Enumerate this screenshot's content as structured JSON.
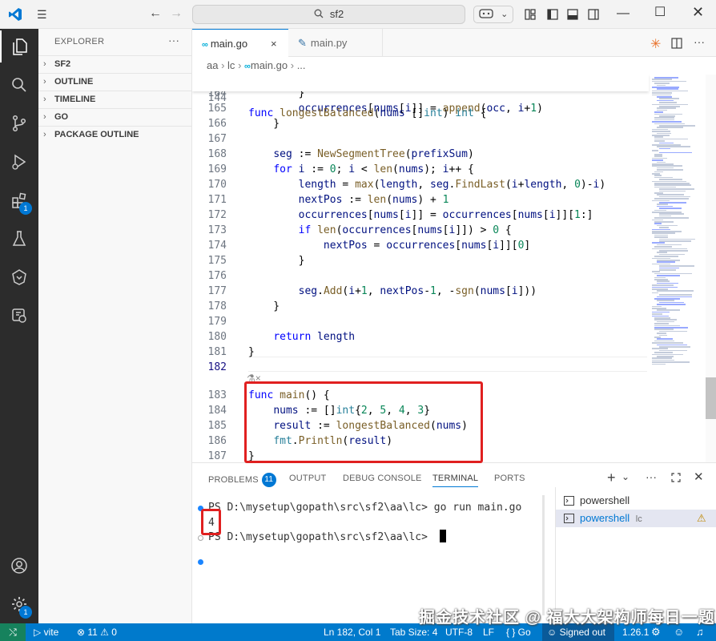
{
  "window": {
    "search_text": "sf2"
  },
  "sidebar": {
    "title": "EXPLORER",
    "more": "···",
    "sections": [
      {
        "label": "SF2"
      },
      {
        "label": "OUTLINE"
      },
      {
        "label": "TIMELINE"
      },
      {
        "label": "GO"
      },
      {
        "label": "PACKAGE OUTLINE"
      }
    ]
  },
  "activity_bar": {
    "extensions_badge": "1",
    "settings_badge": "1"
  },
  "tabs": [
    {
      "label": "main.go",
      "active": true,
      "close": "×"
    },
    {
      "label": "main.py",
      "active": false
    }
  ],
  "breadcrumb": [
    "aa",
    "lc",
    "main.go",
    "..."
  ],
  "editor": {
    "sticky_line": {
      "number": "144",
      "text": "func longestBalanced(nums []int) int {"
    },
    "lines": [
      {
        "number": "164",
        "text": "        }"
      },
      {
        "number": "165",
        "text": "        occurrences[nums[i]] = append(occ, i+1)"
      },
      {
        "number": "166",
        "text": "    }"
      },
      {
        "number": "167",
        "text": ""
      },
      {
        "number": "168",
        "text": "    seg := NewSegmentTree(prefixSum)"
      },
      {
        "number": "169",
        "text": "    for i := 0; i < len(nums); i++ {"
      },
      {
        "number": "170",
        "text": "        length = max(length, seg.FindLast(i+length, 0)-i)"
      },
      {
        "number": "171",
        "text": "        nextPos := len(nums) + 1"
      },
      {
        "number": "172",
        "text": "        occurrences[nums[i]] = occurrences[nums[i]][1:]"
      },
      {
        "number": "173",
        "text": "        if len(occurrences[nums[i]]) > 0 {"
      },
      {
        "number": "174",
        "text": "            nextPos = occurrences[nums[i]][0]"
      },
      {
        "number": "175",
        "text": "        }"
      },
      {
        "number": "176",
        "text": ""
      },
      {
        "number": "177",
        "text": "        seg.Add(i+1, nextPos-1, -sgn(nums[i]))"
      },
      {
        "number": "178",
        "text": "    }"
      },
      {
        "number": "179",
        "text": ""
      },
      {
        "number": "180",
        "text": "    return length"
      },
      {
        "number": "181",
        "text": "}"
      },
      {
        "number": "182",
        "text": ""
      },
      {
        "number": "",
        "text": ""
      },
      {
        "number": "183",
        "text": "func main() {"
      },
      {
        "number": "184",
        "text": "    nums := []int{2, 5, 4, 3}"
      },
      {
        "number": "185",
        "text": "    result := longestBalanced(nums)"
      },
      {
        "number": "186",
        "text": "    fmt.Println(result)"
      },
      {
        "number": "187",
        "text": "}"
      }
    ],
    "current_line": "182"
  },
  "panel": {
    "tabs": [
      {
        "label": "PROBLEMS",
        "badge": "11"
      },
      {
        "label": "OUTPUT"
      },
      {
        "label": "DEBUG CONSOLE"
      },
      {
        "label": "TERMINAL",
        "active": true
      },
      {
        "label": "PORTS"
      }
    ],
    "terminal_lines": [
      "PS D:\\mysetup\\gopath\\src\\sf2\\aa\\lc> go run main.go",
      "4",
      "PS D:\\mysetup\\gopath\\src\\sf2\\aa\\lc> "
    ],
    "terminals": [
      {
        "label": "powershell",
        "suffix": ""
      },
      {
        "label": "powershell",
        "suffix": "lc"
      }
    ]
  },
  "statusbar": {
    "vite": "vite",
    "problems": "⊗ 11 ⚠ 0",
    "position": "Ln 182, Col 1",
    "tab_size": "Tab Size: 4",
    "encoding": "UTF-8",
    "eol": "LF",
    "language": "{ } Go",
    "account": "Signed out",
    "go_version": "1.26.1"
  },
  "watermark": "掘金技术社区 @ 福大大架构师每日一题"
}
